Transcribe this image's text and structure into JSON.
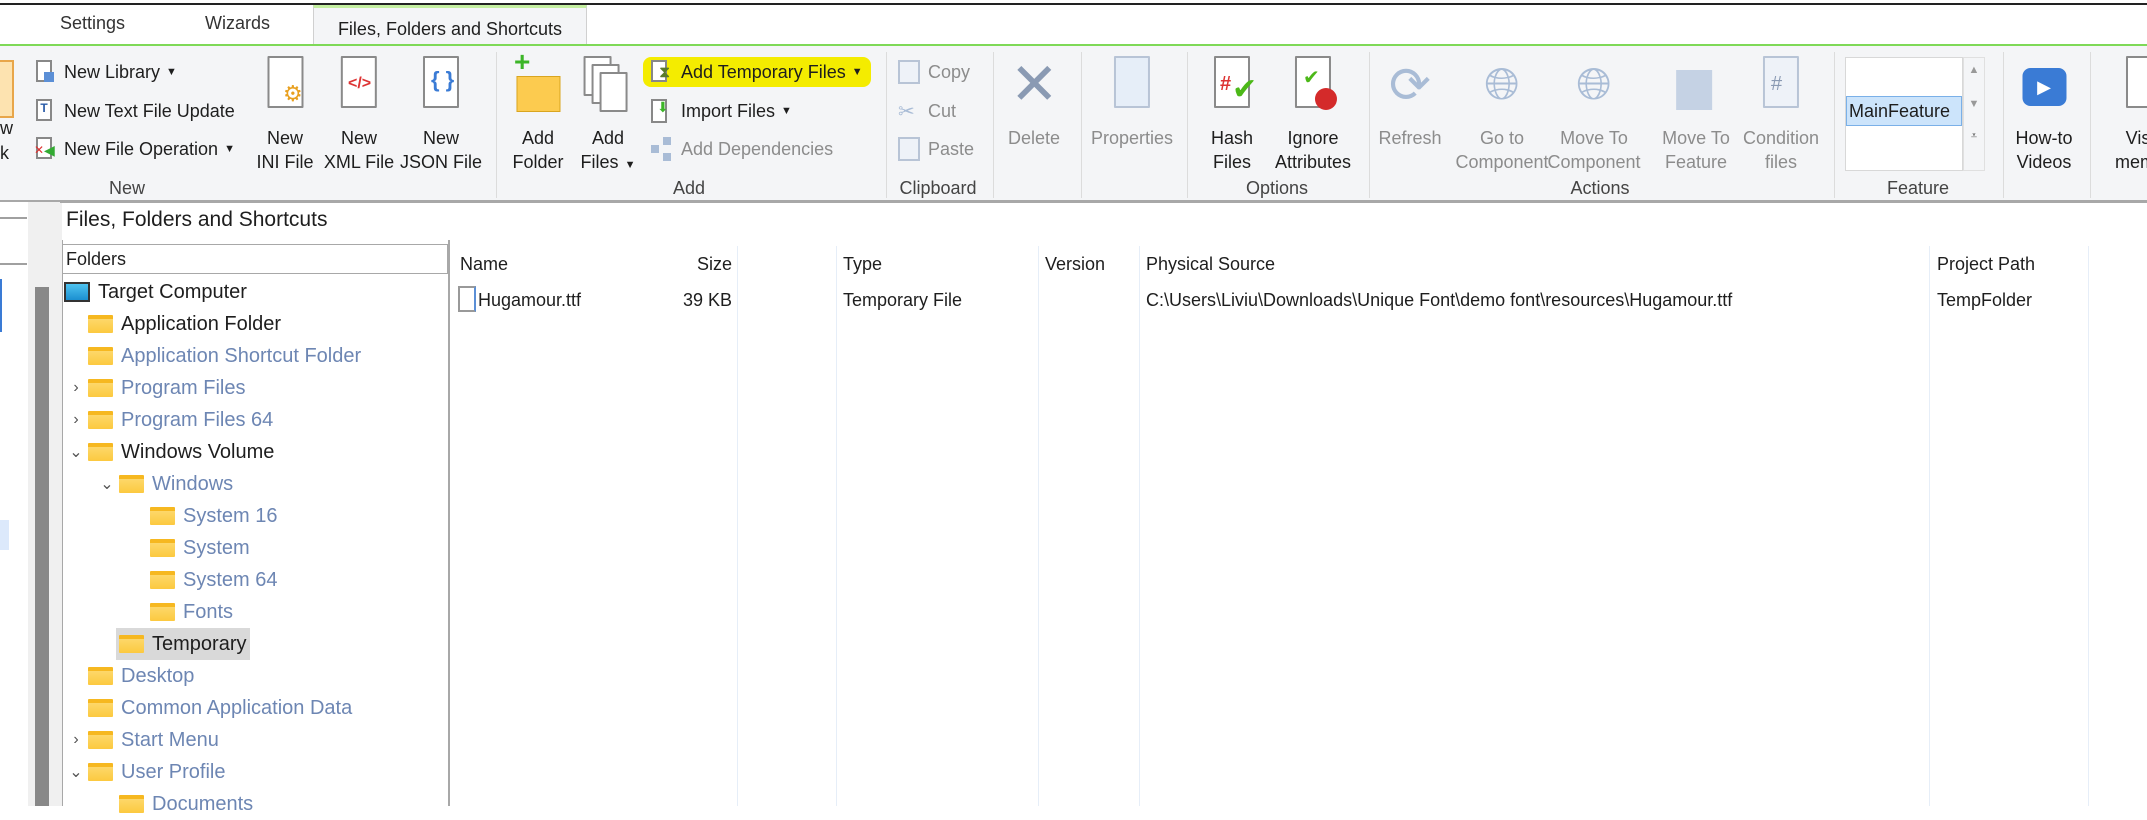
{
  "tabs": [
    {
      "label": "Settings"
    },
    {
      "label": "Wizards"
    },
    {
      "label": "Files, Folders and Shortcuts",
      "active": true
    }
  ],
  "ribbon": {
    "cut_left_top": "w",
    "cut_left_bottom": "k",
    "new_group": {
      "label": "New",
      "small": [
        {
          "label": "New Library",
          "dropdown": true,
          "icon": "library-icon"
        },
        {
          "label": "New Text File Update",
          "icon": "text-file-icon"
        },
        {
          "label": "New File Operation",
          "dropdown": true,
          "icon": "file-operation-icon"
        }
      ],
      "big": [
        {
          "l1": "New",
          "l2": "INI File",
          "icon": "ini-file-icon"
        },
        {
          "l1": "New",
          "l2": "XML File",
          "icon": "xml-file-icon"
        },
        {
          "l1": "New",
          "l2": "JSON File",
          "icon": "json-file-icon"
        }
      ]
    },
    "add_group": {
      "label": "Add",
      "big": [
        {
          "l1": "Add",
          "l2": "Folder",
          "icon": "add-folder-icon"
        },
        {
          "l1": "Add",
          "l2": "Files",
          "dropdown": true,
          "icon": "add-files-icon"
        }
      ],
      "small": [
        {
          "label": "Add Temporary Files",
          "dropdown": true,
          "highlighted": true,
          "icon": "temporary-file-icon"
        },
        {
          "label": "Import Files",
          "dropdown": true,
          "icon": "import-icon"
        },
        {
          "label": "Add Dependencies",
          "disabled": true,
          "icon": "dependencies-icon"
        }
      ]
    },
    "clipboard_group": {
      "label": "Clipboard",
      "small": [
        {
          "label": "Copy",
          "disabled": true
        },
        {
          "label": "Cut",
          "disabled": true
        },
        {
          "label": "Paste",
          "disabled": true
        }
      ]
    },
    "delete": {
      "l1": "Delete",
      "disabled": true
    },
    "properties": {
      "l1": "Properties",
      "disabled": true
    },
    "options_group": {
      "label": "Options",
      "big": [
        {
          "l1": "Hash",
          "l2": "Files"
        },
        {
          "l1": "Ignore",
          "l2": "Attributes"
        }
      ]
    },
    "actions_group": {
      "label": "Actions",
      "big": [
        {
          "l1": "Refresh",
          "disabled": true
        },
        {
          "l1": "Go to",
          "l2": "Component",
          "disabled": true
        },
        {
          "l1": "Move To",
          "l2": "Component",
          "disabled": true
        },
        {
          "l1": "Move To",
          "l2": "Feature",
          "disabled": true
        },
        {
          "l1": "Condition",
          "l2": "files",
          "disabled": true
        }
      ]
    },
    "feature_group": {
      "label": "Feature",
      "selected": "MainFeature"
    },
    "videos": {
      "l1": "How-to",
      "l2": "Videos"
    },
    "visit": {
      "l1": "Visi",
      "l2": "memb"
    },
    "highlight_color": "#f4ec00"
  },
  "panel": {
    "title": "Files, Folders and Shortcuts"
  },
  "tree": {
    "header": "Folders",
    "items": [
      {
        "label": "Target Computer",
        "level": 0,
        "icon": "computer-icon"
      },
      {
        "label": "Application Folder",
        "level": 1
      },
      {
        "label": "Application Shortcut Folder",
        "level": 1,
        "gray": true
      },
      {
        "label": "Program Files",
        "level": 1,
        "gray": true,
        "expander": "collapsed"
      },
      {
        "label": "Program Files 64",
        "level": 1,
        "gray": true,
        "expander": "collapsed"
      },
      {
        "label": "Windows Volume",
        "level": 1,
        "expander": "expanded"
      },
      {
        "label": "Windows",
        "level": 2,
        "gray": true,
        "expander": "expanded"
      },
      {
        "label": "System 16",
        "level": 3,
        "gray": true
      },
      {
        "label": "System",
        "level": 3,
        "gray": true
      },
      {
        "label": "System 64",
        "level": 3,
        "gray": true
      },
      {
        "label": "Fonts",
        "level": 3,
        "gray": true
      },
      {
        "label": "Temporary",
        "level": 2,
        "selected": true
      },
      {
        "label": "Desktop",
        "level": 1,
        "gray": true
      },
      {
        "label": "Common Application Data",
        "level": 1,
        "gray": true
      },
      {
        "label": "Start Menu",
        "level": 1,
        "gray": true,
        "expander": "collapsed"
      },
      {
        "label": "User Profile",
        "level": 1,
        "gray": true,
        "expander": "expanded"
      },
      {
        "label": "Documents",
        "level": 2,
        "gray": true
      }
    ]
  },
  "table": {
    "columns": [
      "Name",
      "Size",
      "Type",
      "Version",
      "Physical Source",
      "Project Path"
    ],
    "rows": [
      {
        "name": "Hugamour.ttf",
        "size": "39 KB",
        "type": "Temporary File",
        "version": "",
        "source": "C:\\Users\\Liviu\\Downloads\\Unique Font\\demo font\\resources\\Hugamour.ttf",
        "project_path": "TempFolder"
      }
    ]
  }
}
